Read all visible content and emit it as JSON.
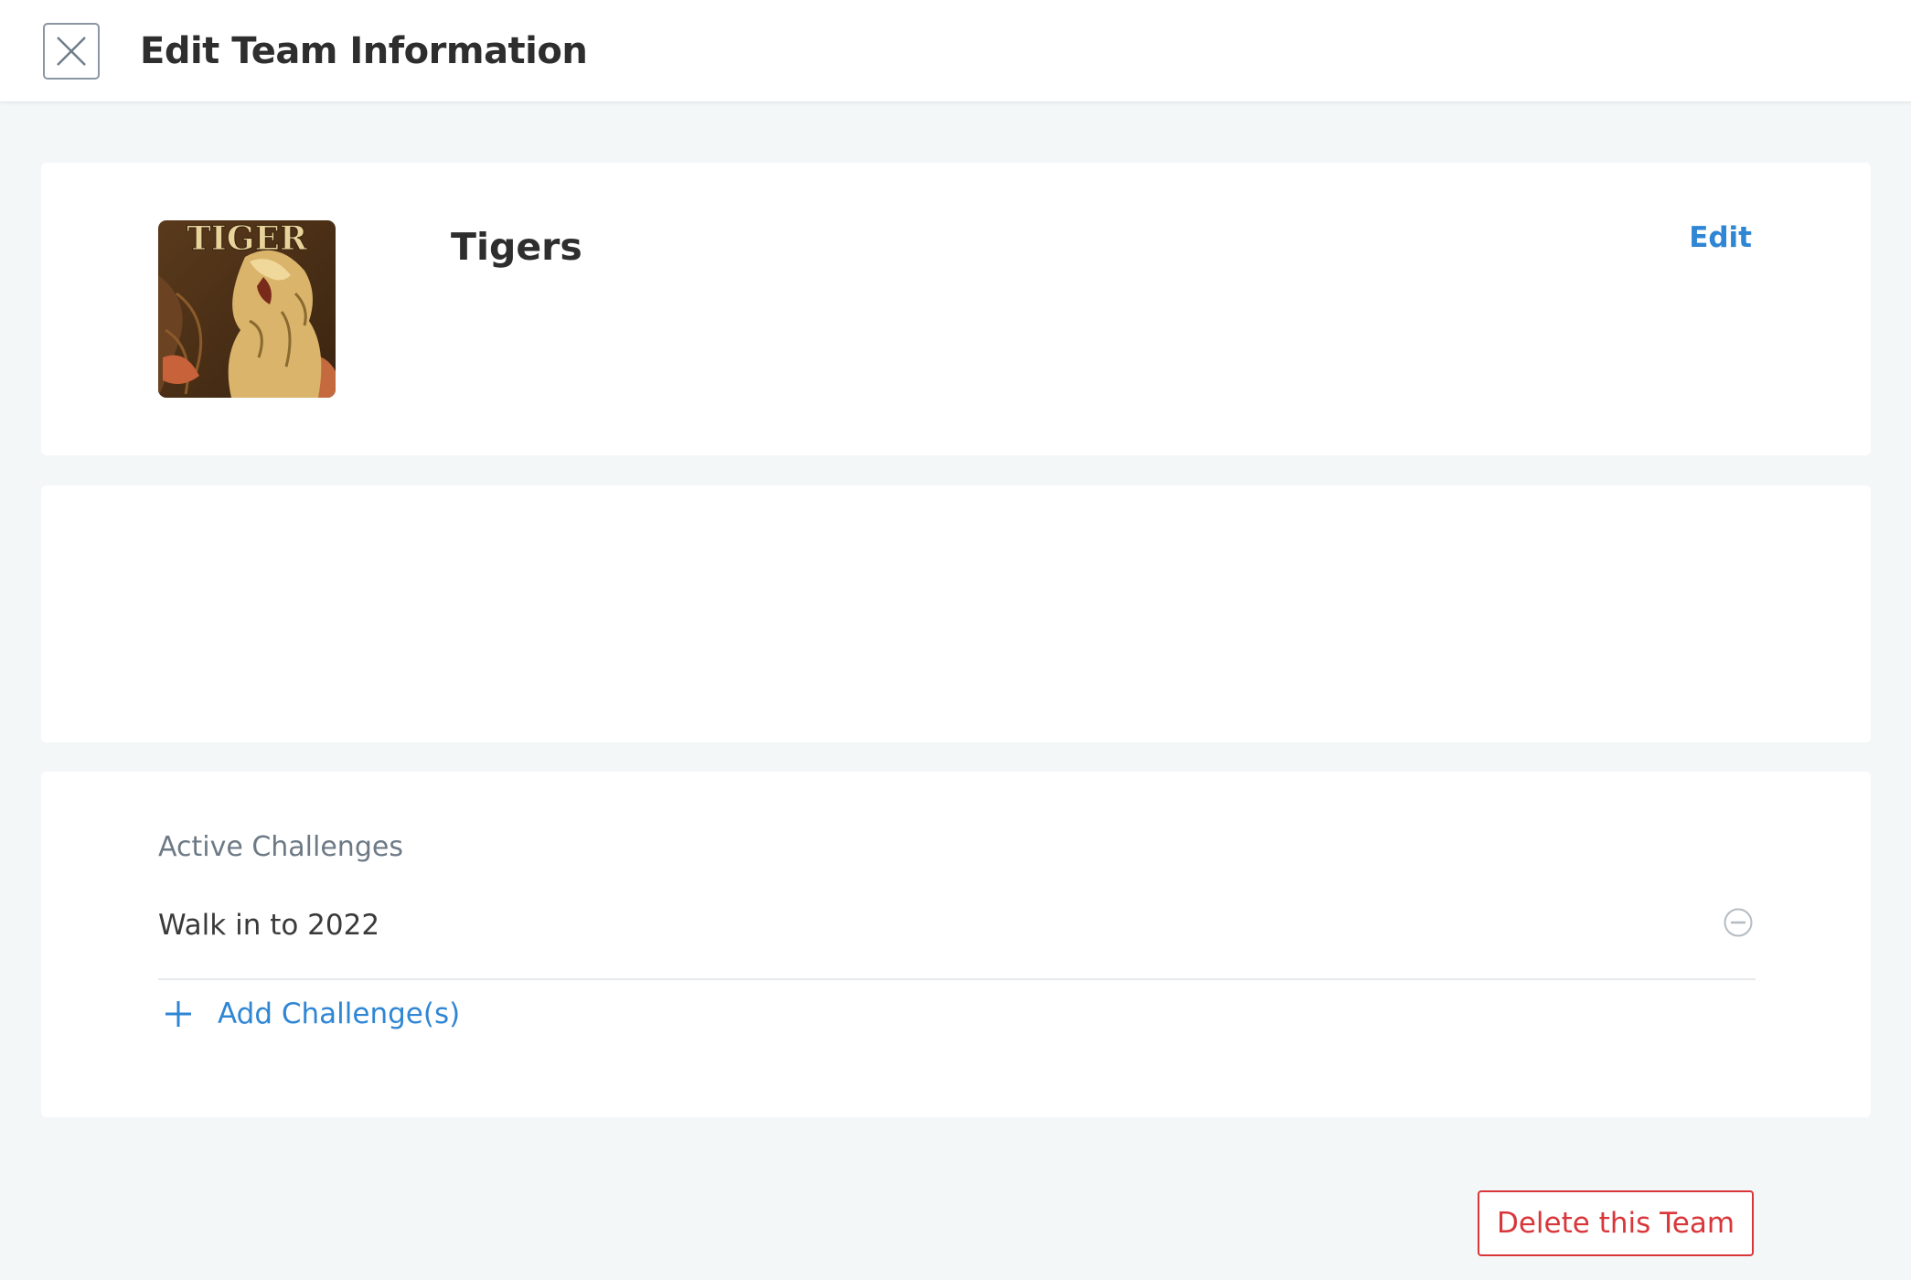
{
  "header": {
    "title": "Edit Team Information",
    "close_icon": "close-icon"
  },
  "team": {
    "name": "Tigers",
    "edit_label": "Edit",
    "image_label": "TIGER"
  },
  "challenges": {
    "section_label": "Active Challenges",
    "items": [
      {
        "name": "Walk in to 2022",
        "remove_icon": "remove-circle-icon"
      }
    ],
    "add_label": "Add Challenge(s)",
    "add_icon": "plus-icon"
  },
  "actions": {
    "delete_label": "Delete this Team"
  },
  "colors": {
    "accent": "#2f86d4",
    "danger": "#d9363a",
    "background": "#f4f7f8"
  }
}
